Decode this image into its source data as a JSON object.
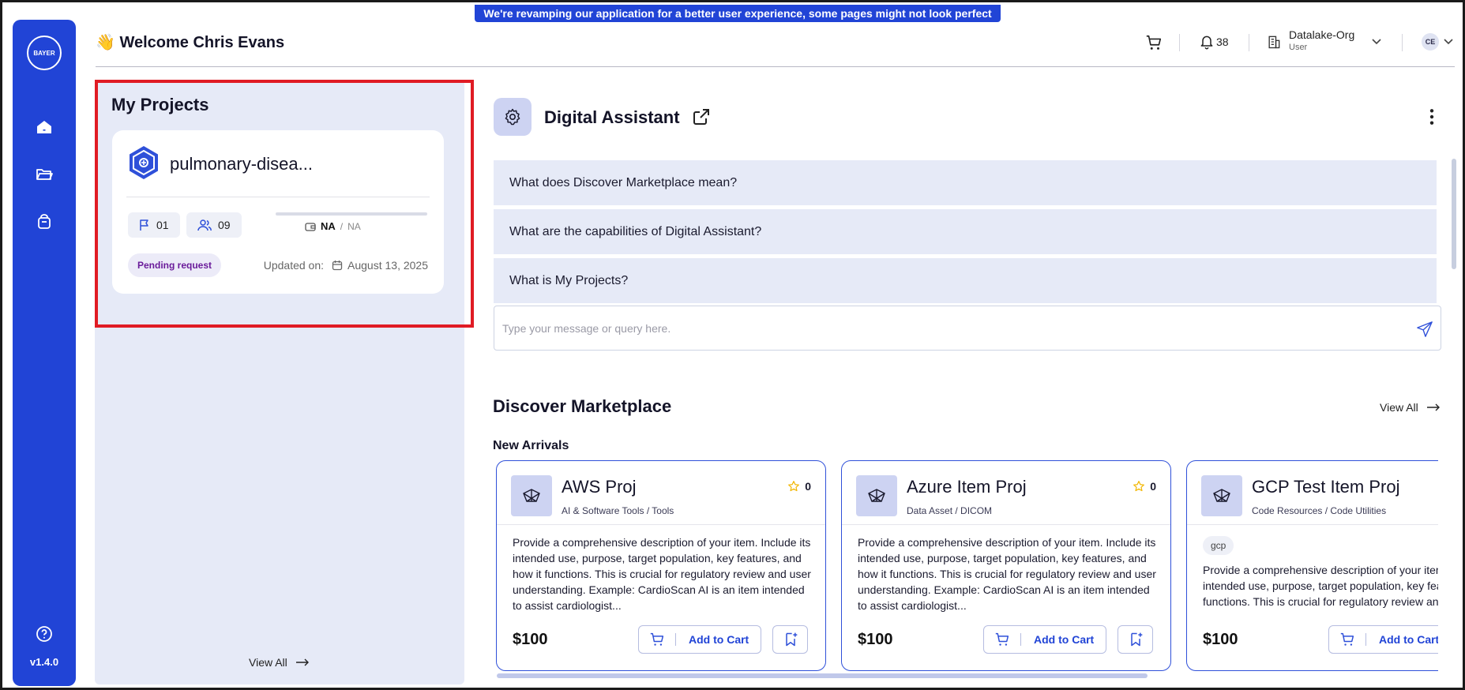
{
  "banner": "We're revamping our application for a better user experience, some pages might not look perfect yet!",
  "sidebar": {
    "logo_text": "BAYER",
    "version": "v1.4.0"
  },
  "header": {
    "welcome_emoji": "👋",
    "welcome": "Welcome Chris Evans",
    "notification_count": "38",
    "org_name": "Datalake-Org",
    "org_role": "User",
    "avatar_initials": "CE"
  },
  "my_projects": {
    "title": "My Projects",
    "view_all": "View All",
    "project": {
      "name": "pulmonary-disea...",
      "flags": "01",
      "members": "09",
      "budget_used": "NA",
      "budget_total": "NA",
      "status": "Pending request",
      "updated_label": "Updated on:",
      "updated_date": "August 13, 2025"
    }
  },
  "assistant": {
    "title": "Digital Assistant",
    "questions": [
      "What does Discover Marketplace mean?",
      "What are the capabilities of Digital Assistant?",
      "What is My Projects?"
    ],
    "input_placeholder": "Type your message or query here."
  },
  "marketplace": {
    "title": "Discover Marketplace",
    "view_all": "View All",
    "section": "New Arrivals",
    "add_to_cart": "Add to Cart",
    "items": [
      {
        "title": "AWS Proj",
        "category": "AI & Software Tools / Tools",
        "rating": "0",
        "tag": "",
        "description": "Provide a comprehensive description of your item. Include its intended use, purpose, target population, key features, and how it functions. This is crucial for regulatory review and user understanding. Example: CardioScan AI is an item intended to assist cardiologist...",
        "price": "$100"
      },
      {
        "title": "Azure Item Proj",
        "category": "Data Asset / DICOM",
        "rating": "0",
        "tag": "",
        "description": "Provide a comprehensive description of your item. Include its intended use, purpose, target population, key features, and how it functions. This is crucial for regulatory review and user understanding. Example: CardioScan AI is an item intended to assist cardiologist...",
        "price": "$100"
      },
      {
        "title": "GCP Test Item Proj",
        "category": "Code Resources / Code Utilities",
        "rating": "",
        "tag": "gcp",
        "description": "Provide a comprehensive description of your item. Include its intended use, purpose, target population, key features, and how it functions. This is crucial for regulatory review and user understanding.",
        "price": "$100"
      }
    ]
  },
  "colors": {
    "brand": "#2144d6",
    "highlight_frame": "#e01b24",
    "pending": "#6a1b9a",
    "star": "#f2b600"
  }
}
